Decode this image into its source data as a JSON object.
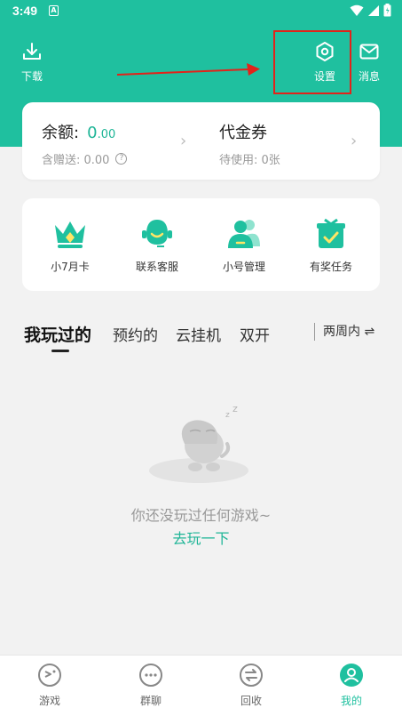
{
  "status_bar": {
    "time": "3:49",
    "notif_badge": "A"
  },
  "top_bar": {
    "download_label": "下载",
    "settings_label": "设置",
    "message_label": "消息"
  },
  "balance": {
    "title": "余额:",
    "value_int": "0",
    "value_dec": ".00",
    "gift_text": "含赠送: 0.00"
  },
  "voucher": {
    "title": "代金券",
    "pending_text": "待使用: 0张"
  },
  "functions": [
    {
      "label": "小7月卡",
      "icon": "crown-icon"
    },
    {
      "label": "联系客服",
      "icon": "customer-service-icon"
    },
    {
      "label": "小号管理",
      "icon": "accounts-icon"
    },
    {
      "label": "有奖任务",
      "icon": "gift-task-icon"
    }
  ],
  "tabs": [
    {
      "label": "我玩过的",
      "active": true
    },
    {
      "label": "预约的",
      "active": false
    },
    {
      "label": "云挂机",
      "active": false
    },
    {
      "label": "双开",
      "active": false
    }
  ],
  "period_filter": "两周内 ⇌",
  "empty_state": {
    "message": "你还没玩过任何游戏~",
    "action": "去玩一下"
  },
  "bottom_nav": [
    {
      "label": "游戏",
      "icon": "game-icon",
      "active": false
    },
    {
      "label": "群聊",
      "icon": "chat-icon",
      "active": false
    },
    {
      "label": "回收",
      "icon": "recycle-icon",
      "active": false
    },
    {
      "label": "我的",
      "icon": "profile-icon",
      "active": true
    }
  ],
  "colors": {
    "accent": "#1fc09f",
    "highlight": "#e2231a"
  }
}
